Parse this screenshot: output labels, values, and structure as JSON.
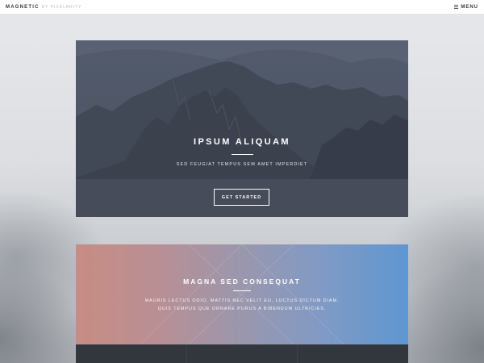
{
  "header": {
    "logo": "MAGNETIC",
    "byline": "BY PIXELARITY",
    "menu_label": "MENU"
  },
  "banner": {
    "title": "IPSUM ALIQUAM",
    "subtitle": "SED FEUGIAT TEMPUS SEM AMET IMPERDIET",
    "button_label": "GET STARTED"
  },
  "feature": {
    "title": "MAGNA SED CONSEQUAT",
    "text": "MAURIS LECTUS ODIO, MATTIS NEC VELIT EU, LUCTUS DICTUM DIAM. QUIS TEMPUS QUE ORNARE PURUS A BIBENDUM ULTRICIES."
  },
  "colors": {
    "banner_overlay": "#484d5a",
    "feature_gradient_start": "#c78c84",
    "feature_gradient_end": "#5e97d0",
    "dark_strip": "#32363d"
  },
  "icons": {
    "menu": "hamburger-icon"
  }
}
